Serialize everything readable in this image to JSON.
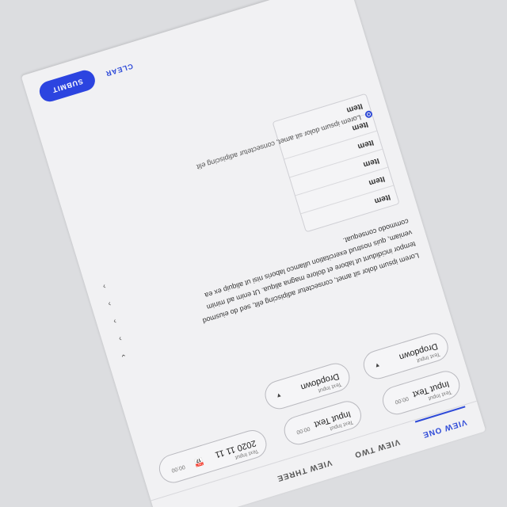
{
  "tabs": [
    {
      "label": "VIEW ONE",
      "active": true
    },
    {
      "label": "VIEW TWO",
      "active": false
    },
    {
      "label": "VIEW THREE",
      "active": false
    }
  ],
  "fields": {
    "r1c1": {
      "label": "Text Input",
      "value": "Input Text",
      "hint": "00:00"
    },
    "r1c2": {
      "label": "Text Input",
      "value": "Input Text",
      "hint": "00:00"
    },
    "r1c3": {
      "label": "Text Input",
      "value": "2020 11 11",
      "hint": "00:00"
    },
    "r2c1": {
      "label": "Text Input",
      "value": "Dropdown"
    },
    "r2c2": {
      "label": "Text Input",
      "value": "Dropdown"
    }
  },
  "description": "Lorem ipsum dolor sit amet, consectetur adipiscing elit, sed do eiusmod tempor incididunt ut labore et dolore magna aliqua. Ut enim ad minim veniam, quis nostrud exercitation ullamco laboris nisi ut aliquip ex ea commodo consequat.",
  "list": [
    "Item",
    "Item",
    "Item",
    "Item",
    "Item",
    "Item"
  ],
  "optin": "Lorem ipsum dolor sit amet, consectetur adipiscing elit",
  "footer": {
    "cancel": "CLEAR",
    "submit": "SUBMIT"
  }
}
